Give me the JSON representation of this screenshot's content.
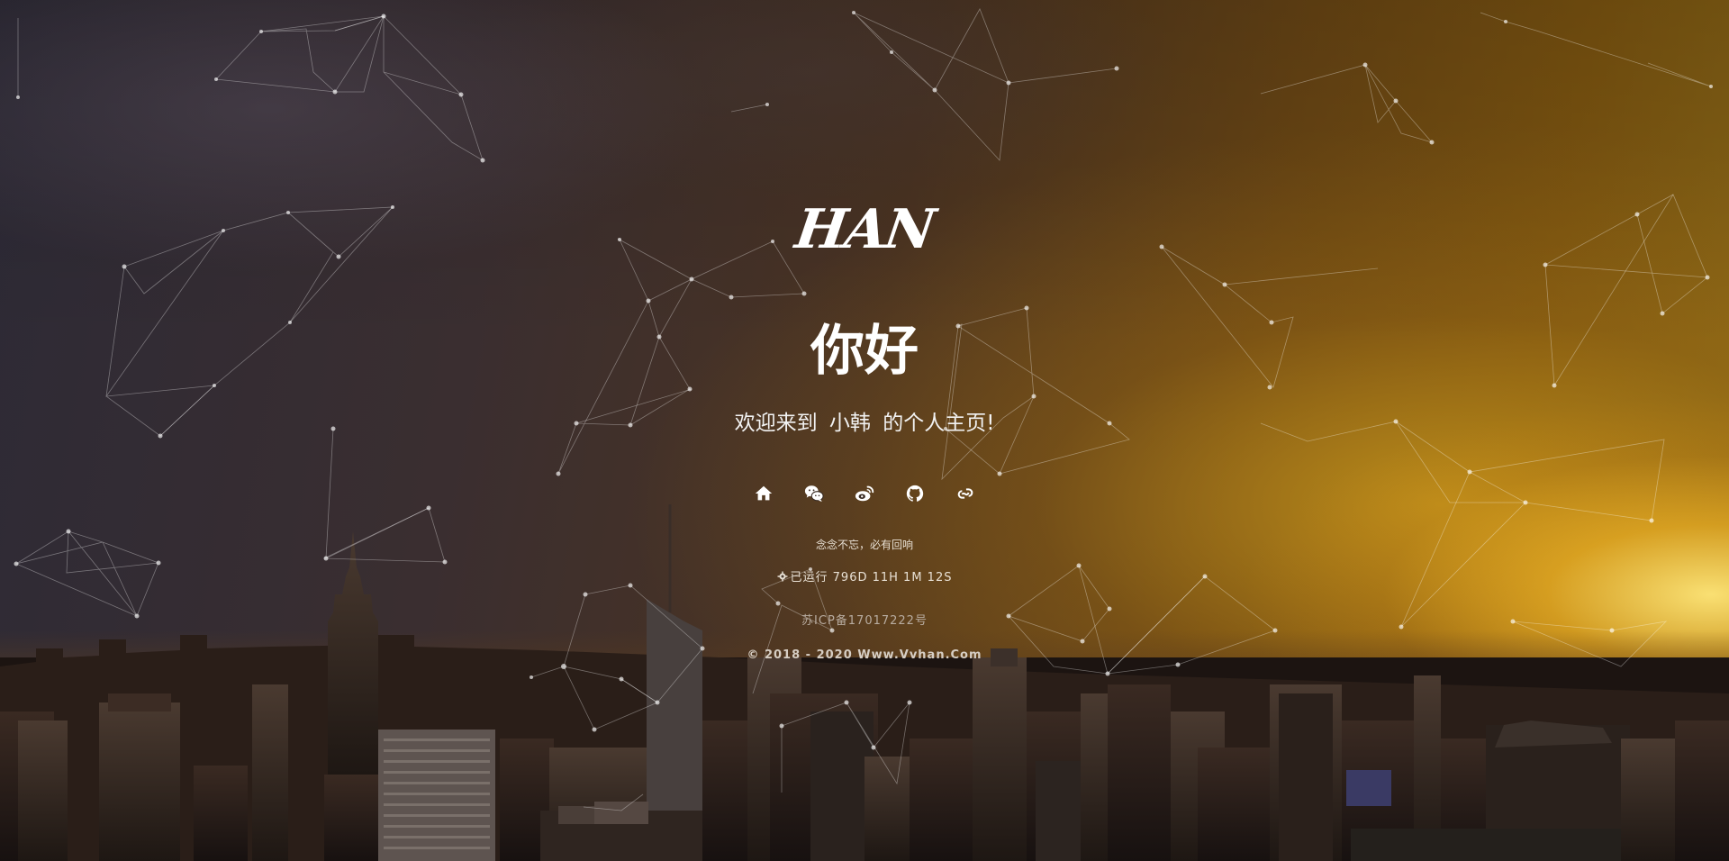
{
  "logo": {
    "text": "HAN"
  },
  "hero": {
    "greeting": "你好",
    "welcome_prefix": "欢迎来到",
    "name": "小韩",
    "welcome_suffix": "的个人主页!"
  },
  "social_links": [
    {
      "icon": "home-icon"
    },
    {
      "icon": "wechat-icon"
    },
    {
      "icon": "weibo-icon"
    },
    {
      "icon": "github-icon"
    },
    {
      "icon": "link-icon"
    }
  ],
  "motto": "念念不忘，必有回响",
  "uptime": {
    "label": "已运行",
    "value": "796D 11H 1M 12S"
  },
  "icp": "苏ICP备17017222号",
  "copyright": "© 2018 - 2020 Www.Vvhan.Com",
  "colors": {
    "text": "#ffffff",
    "sky_left": "#2d2a36",
    "sunset": "#d9a21e"
  }
}
